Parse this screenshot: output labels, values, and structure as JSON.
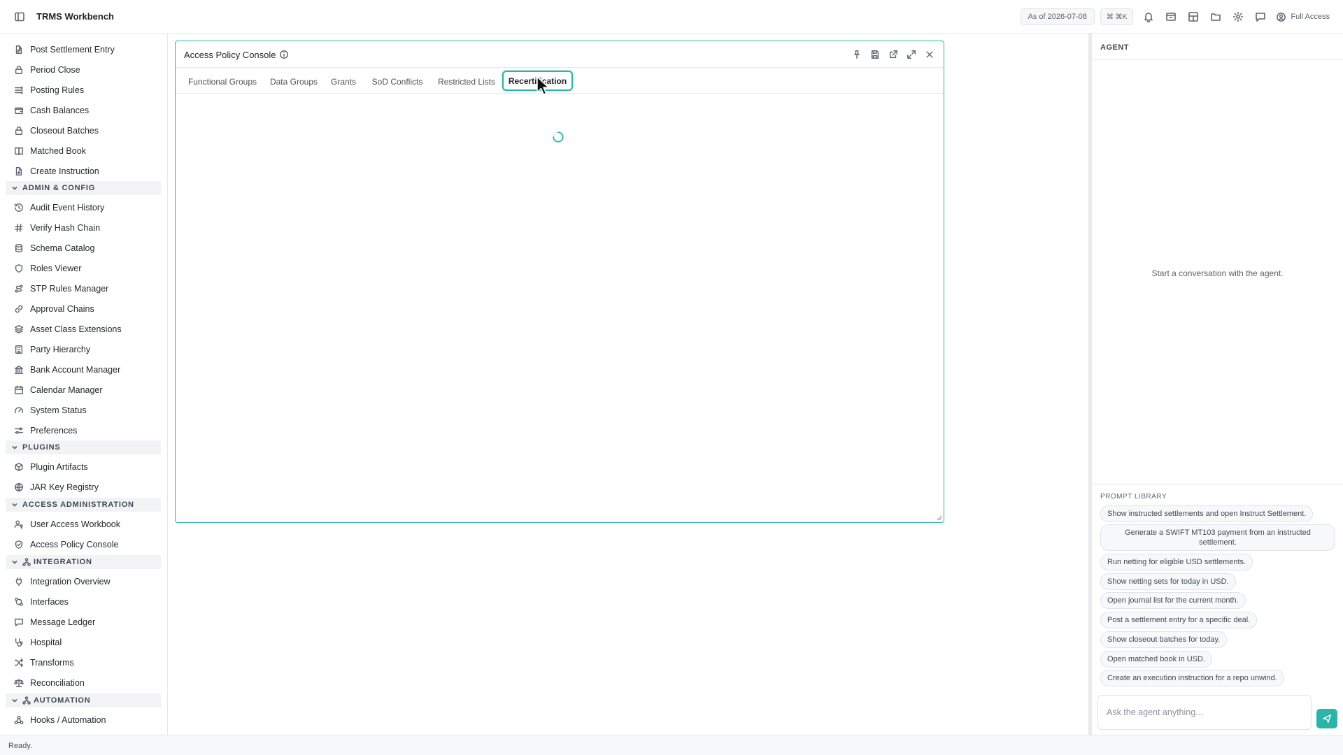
{
  "app": {
    "title": "TRMS Workbench",
    "as_of": "As of 2026-07-08",
    "shortcut": "⌘ ⌘K",
    "access_label": "Full Access"
  },
  "topbar_icons": [
    "sidebar-icon",
    "bell-icon",
    "archive-icon",
    "layout-icon",
    "folder-icon",
    "gear-icon",
    "chat-icon",
    "user-circle-icon"
  ],
  "sidebar": {
    "items_top": [
      {
        "label": "Post Settlement Entry",
        "icon": "file-edit-icon"
      },
      {
        "label": "Period Close",
        "icon": "lock-icon"
      },
      {
        "label": "Posting Rules",
        "icon": "list-rules-icon"
      },
      {
        "label": "Cash Balances",
        "icon": "wallet-icon"
      },
      {
        "label": "Closeout Batches",
        "icon": "lock-icon"
      },
      {
        "label": "Matched Book",
        "icon": "book-icon"
      },
      {
        "label": "Create Instruction",
        "icon": "file-plus-icon"
      }
    ],
    "sections": {
      "admin": "ADMIN & CONFIG",
      "plugins": "PLUGINS",
      "access": "ACCESS ADMINISTRATION",
      "integration": "INTEGRATION",
      "automation": "AUTOMATION"
    },
    "admin_items": [
      {
        "label": "Audit Event History",
        "icon": "history-icon"
      },
      {
        "label": "Verify Hash Chain",
        "icon": "hash-icon"
      },
      {
        "label": "Schema Catalog",
        "icon": "database-icon"
      },
      {
        "label": "Roles Viewer",
        "icon": "shield-icon"
      },
      {
        "label": "STP Rules Manager",
        "icon": "route-icon"
      },
      {
        "label": "Approval Chains",
        "icon": "link-icon"
      },
      {
        "label": "Asset Class Extensions",
        "icon": "layers-icon"
      },
      {
        "label": "Party Hierarchy",
        "icon": "building-icon"
      },
      {
        "label": "Bank Account Manager",
        "icon": "bank-icon"
      },
      {
        "label": "Calendar Manager",
        "icon": "calendar-icon"
      },
      {
        "label": "System Status",
        "icon": "gauge-icon"
      },
      {
        "label": "Preferences",
        "icon": "sliders-icon"
      }
    ],
    "plugin_items": [
      {
        "label": "Plugin Artifacts",
        "icon": "package-icon"
      },
      {
        "label": "JAR Key Registry",
        "icon": "globe-icon"
      }
    ],
    "access_items": [
      {
        "label": "User Access Workbook",
        "icon": "user-key-icon"
      },
      {
        "label": "Access Policy Console",
        "icon": "shield-check-icon"
      }
    ],
    "integration_items": [
      {
        "label": "Integration Overview",
        "icon": "plug-icon"
      },
      {
        "label": "Interfaces",
        "icon": "interface-icon"
      },
      {
        "label": "Message Ledger",
        "icon": "message-icon"
      },
      {
        "label": "Hospital",
        "icon": "stethoscope-icon"
      },
      {
        "label": "Transforms",
        "icon": "shuffle-icon"
      },
      {
        "label": "Reconciliation",
        "icon": "scale-icon"
      }
    ],
    "automation_items": [
      {
        "label": "Hooks / Automation",
        "icon": "webhook-icon"
      }
    ]
  },
  "panel": {
    "title": "Access Policy Console",
    "tabs": [
      {
        "label": "Functional Groups",
        "active": false
      },
      {
        "label": "Data Groups",
        "active": false
      },
      {
        "label": "Grants",
        "active": false
      },
      {
        "label": "SoD Conflicts",
        "active": false
      },
      {
        "label": "Restricted Lists",
        "active": false
      },
      {
        "label": "Recertification",
        "active": true
      }
    ],
    "loading": true
  },
  "agent": {
    "title": "AGENT",
    "empty_message": "Start a conversation with the agent.",
    "prompt_library_label": "PROMPT LIBRARY",
    "prompts": [
      "Show instructed settlements and open Instruct Settlement.",
      "Generate a SWIFT MT103 payment from an instructed settlement.",
      "Run netting for eligible USD settlements.",
      "Show netting sets for today in USD.",
      "Open journal list for the current month.",
      "Post a settlement entry for a specific deal.",
      "Show closeout batches for today.",
      "Open matched book in USD.",
      "Create an execution instruction for a repo unwind."
    ],
    "input_placeholder": "Ask the agent anything..."
  },
  "status": {
    "text": "Ready."
  },
  "colors": {
    "accent": "#2bb5a8",
    "border": "#e4e6ea",
    "section_bg": "#f2f3f5"
  }
}
